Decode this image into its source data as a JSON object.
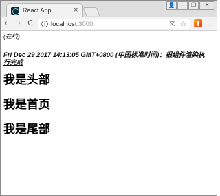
{
  "tab": {
    "title": "React App",
    "close_glyph": "×"
  },
  "window_controls": {
    "user_glyph": "👤",
    "minimize_glyph": "–",
    "restore_glyph": "❐",
    "close_glyph": "✕"
  },
  "toolbar": {
    "back_glyph": "←",
    "forward_glyph": "→",
    "reload_glyph": "C",
    "info_glyph": "i",
    "url_host": "localhost",
    "url_port": ":3000",
    "translate_glyph": "文",
    "star_glyph": "☆",
    "menu_glyph": "⋮"
  },
  "page": {
    "status": "(在线)",
    "timestamp": "Fri Dec 29 2017 14:13:05 GMT+0800 (中国标准时间)：根组件渲染执行完成",
    "header_text": "我是头部",
    "home_text": "我是首页",
    "footer_text": "我是尾部"
  },
  "colors": {
    "react_logo": "#61dafb",
    "url_port": "#9a9a9a"
  }
}
